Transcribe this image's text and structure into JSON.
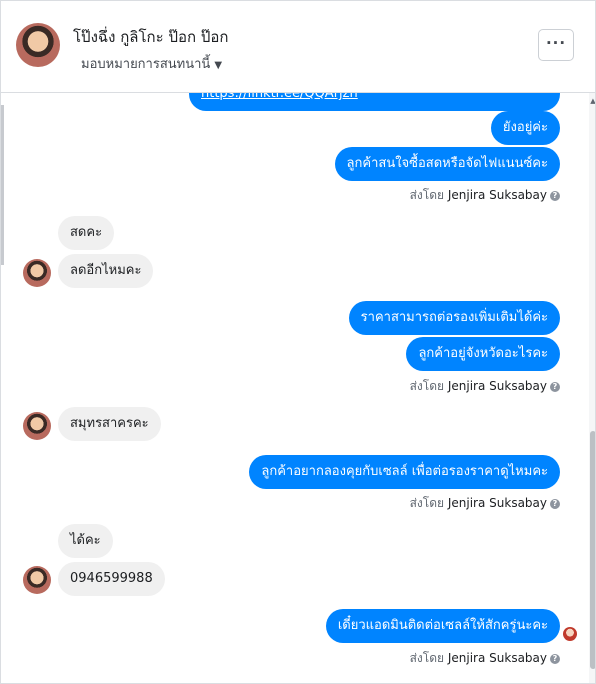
{
  "header": {
    "name": "โป๊งฉึ่ง กูลิโกะ ป๊อก ป๊อก",
    "assign_label": "มอบหมายการสนทนานี้",
    "more_label": "···"
  },
  "messages": {
    "m1": "https://linktr.ee/QQArjzh",
    "m2": "ยังอยู่ค่ะ",
    "m3": "ลูกค้าสนใจซื้อสดหรือจัดไฟแนนซ์คะ",
    "m4": "สดคะ",
    "m5": "ลดอีกไหมคะ",
    "m6": "ราคาสามารถต่อรองเพิ่มเติมได้ค่ะ",
    "m7": "ลูกค้าอยู่จังหวัดอะไรคะ",
    "m8": "สมุทรสาครคะ",
    "m9": "ลูกค้าอยากลองคุยกับเซลล์ เพื่อต่อรองราคาดูไหมคะ",
    "m10": "ได้คะ",
    "m11": "0946599988",
    "m12": "เดี๋ยวแอดมินติดต่อเซลล์ให้สักครู่นะคะ"
  },
  "sent_by": {
    "prefix": "ส่งโดย",
    "name": "Jenjira Suksabay",
    "help": "?"
  },
  "colors": {
    "outgoing": "#0084ff",
    "incoming": "#f0f0f0"
  }
}
